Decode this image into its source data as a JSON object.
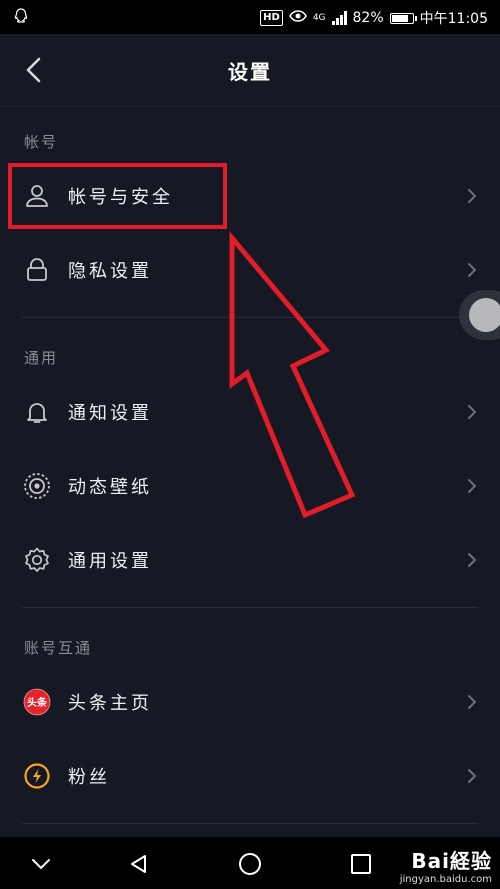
{
  "status_bar": {
    "hd": "HD",
    "network": "4G",
    "battery_pct": "82%",
    "battery_level": 0.82,
    "time": "中午11:05"
  },
  "header": {
    "title": "设置"
  },
  "sections": [
    {
      "title": "帐号",
      "items": [
        {
          "label": "帐号与安全",
          "icon": "user-icon"
        },
        {
          "label": "隐私设置",
          "icon": "lock-icon"
        }
      ]
    },
    {
      "title": "通用",
      "items": [
        {
          "label": "通知设置",
          "icon": "bell-icon"
        },
        {
          "label": "动态壁纸",
          "icon": "wallpaper-icon"
        },
        {
          "label": "通用设置",
          "icon": "gear-icon"
        }
      ]
    },
    {
      "title": "账号互通",
      "items": [
        {
          "label": "头条主页",
          "icon": "toutiao-icon"
        },
        {
          "label": "粉丝",
          "icon": "fans-icon"
        }
      ]
    }
  ],
  "toutiao_badge": "头条",
  "watermark": {
    "logo": "Bai経验",
    "site": "jingyan.baidu.com"
  },
  "colors": {
    "background": "#161823",
    "annotation_red": "#e11d2a",
    "toutiao_red": "#e8232c",
    "fans_orange": "#f5a623"
  }
}
